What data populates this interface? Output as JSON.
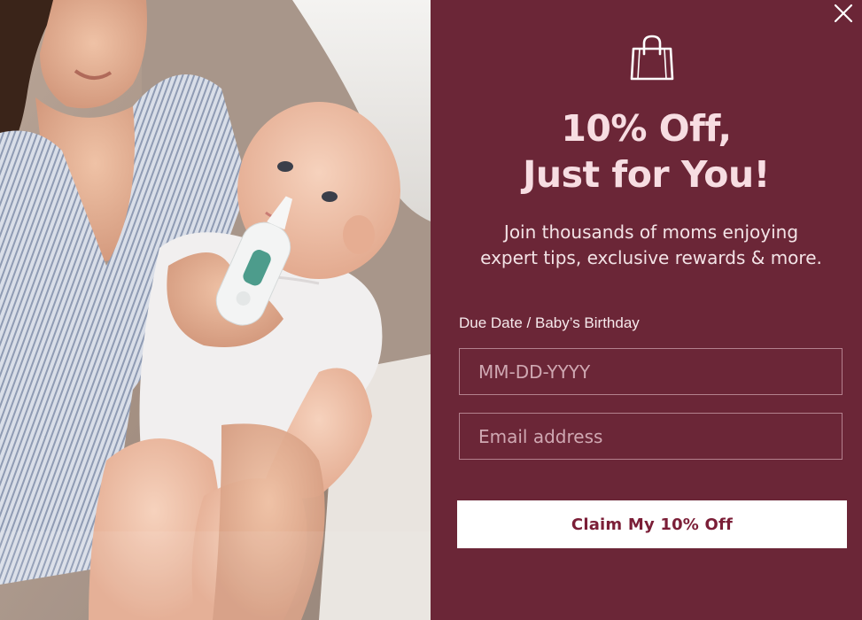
{
  "photo": {
    "alt": "Mother holding baby while using nasal aspirator"
  },
  "close": {
    "icon": "close-icon"
  },
  "offer": {
    "icon": "shopping-bag-icon",
    "headline_line1": "10% Off,",
    "headline_line2": "Just for You!",
    "subtext_line1": "Join thousands of moms enjoying",
    "subtext_line2": "expert tips, exclusive rewards & more."
  },
  "form": {
    "due_date_label": "Due Date / Baby’s Birthday",
    "due_date_placeholder": "MM-DD-YYYY",
    "email_placeholder": "Email address",
    "submit_label": "Claim My 10% Off"
  },
  "colors": {
    "panel_bg": "#6b2637",
    "headline": "#f7dde2",
    "button_bg": "#ffffff",
    "button_text": "#7b1e37"
  }
}
